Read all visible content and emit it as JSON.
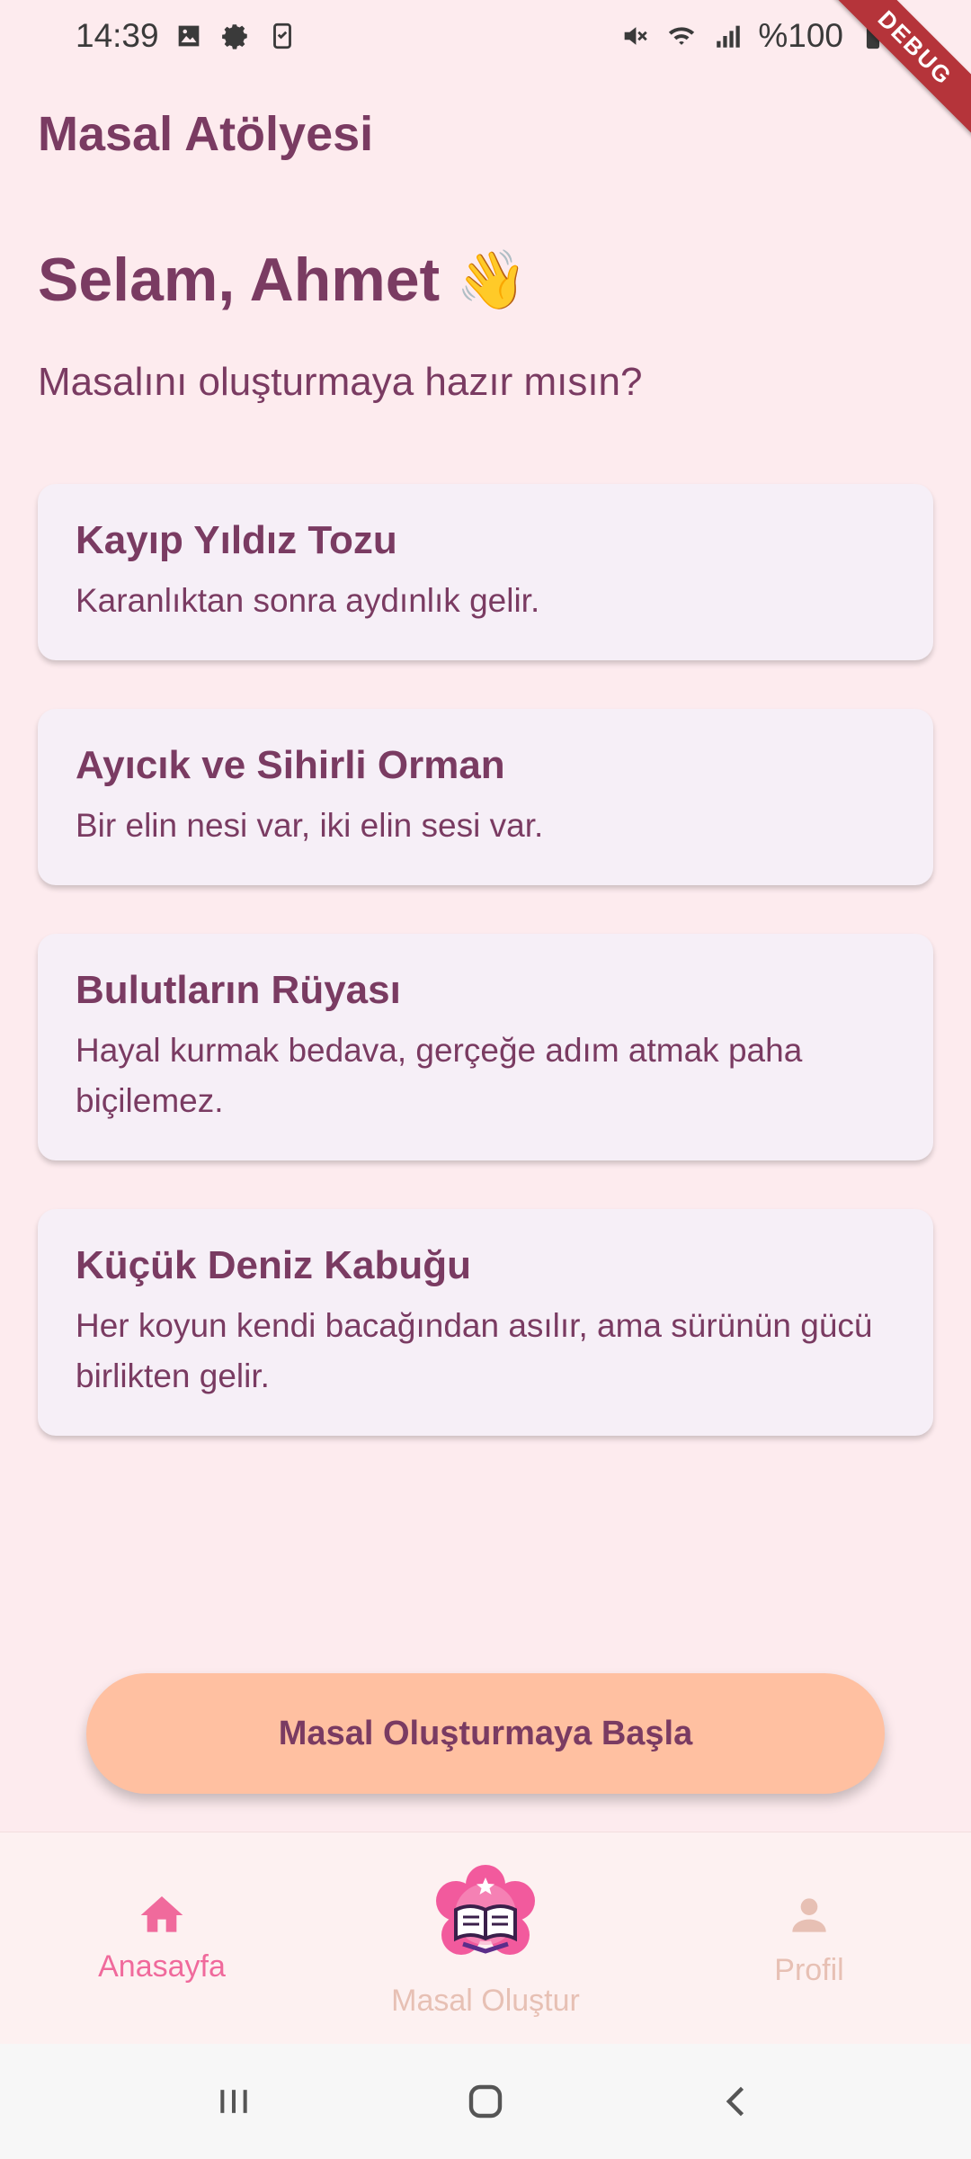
{
  "status_bar": {
    "time": "14:39",
    "battery": "%100",
    "icons_left": [
      "image-icon",
      "gear-icon",
      "clipboard-icon"
    ],
    "icons_right": [
      "mute-icon",
      "wifi-icon",
      "signal-icon",
      "battery-icon"
    ]
  },
  "debug_banner": "DEBUG",
  "app": {
    "title": "Masal Atölyesi"
  },
  "header": {
    "greeting": "Selam, Ahmet",
    "greeting_emoji": "👋",
    "subtitle": "Masalını oluşturmaya hazır mısın?"
  },
  "stories": [
    {
      "title": "Kayıp Yıldız Tozu",
      "description": "Karanlıktan sonra aydınlık gelir."
    },
    {
      "title": "Ayıcık ve Sihirli Orman",
      "description": "Bir elin nesi var, iki elin sesi var."
    },
    {
      "title": "Bulutların Rüyası",
      "description": "Hayal kurmak bedava, gerçeğe adım atmak paha biçilemez."
    },
    {
      "title": "Küçük Deniz Kabuğu",
      "description": "Her koyun kendi bacağından asılır, ama sürünün gücü birlikten gelir."
    }
  ],
  "start_button": {
    "label": "Masal Oluşturmaya Başla"
  },
  "bottom_nav": {
    "items": [
      {
        "label": "Anasayfa",
        "icon": "home-icon",
        "active": true
      },
      {
        "label": "Masal Oluştur",
        "icon": "storybook-icon",
        "active": false
      },
      {
        "label": "Profil",
        "icon": "person-icon",
        "active": false
      }
    ]
  },
  "colors": {
    "background": "#fdebee",
    "primary_text": "#7a3b62",
    "card_bg": "#f6eff7",
    "button_bg": "#ffc0a1",
    "nav_active": "#f06a9c",
    "nav_inactive": "#e7c0b4"
  }
}
